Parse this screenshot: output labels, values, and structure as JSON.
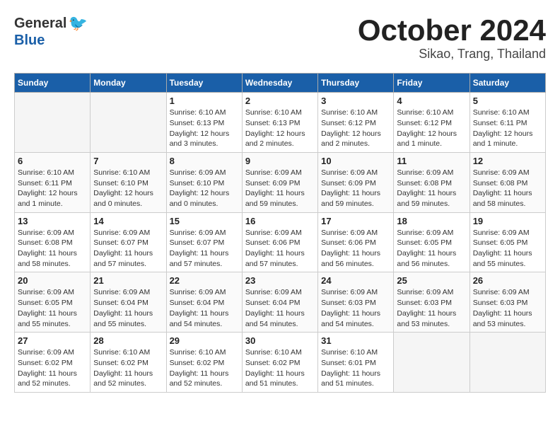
{
  "header": {
    "logo_general": "General",
    "logo_blue": "Blue",
    "month": "October 2024",
    "location": "Sikao, Trang, Thailand"
  },
  "weekdays": [
    "Sunday",
    "Monday",
    "Tuesday",
    "Wednesday",
    "Thursday",
    "Friday",
    "Saturday"
  ],
  "weeks": [
    [
      {
        "day": "",
        "empty": true
      },
      {
        "day": "",
        "empty": true
      },
      {
        "day": "1",
        "sunrise": "6:10 AM",
        "sunset": "6:13 PM",
        "daylight": "12 hours and 3 minutes."
      },
      {
        "day": "2",
        "sunrise": "6:10 AM",
        "sunset": "6:13 PM",
        "daylight": "12 hours and 2 minutes."
      },
      {
        "day": "3",
        "sunrise": "6:10 AM",
        "sunset": "6:12 PM",
        "daylight": "12 hours and 2 minutes."
      },
      {
        "day": "4",
        "sunrise": "6:10 AM",
        "sunset": "6:12 PM",
        "daylight": "12 hours and 1 minute."
      },
      {
        "day": "5",
        "sunrise": "6:10 AM",
        "sunset": "6:11 PM",
        "daylight": "12 hours and 1 minute."
      }
    ],
    [
      {
        "day": "6",
        "sunrise": "6:10 AM",
        "sunset": "6:11 PM",
        "daylight": "12 hours and 1 minute."
      },
      {
        "day": "7",
        "sunrise": "6:10 AM",
        "sunset": "6:10 PM",
        "daylight": "12 hours and 0 minutes."
      },
      {
        "day": "8",
        "sunrise": "6:09 AM",
        "sunset": "6:10 PM",
        "daylight": "12 hours and 0 minutes."
      },
      {
        "day": "9",
        "sunrise": "6:09 AM",
        "sunset": "6:09 PM",
        "daylight": "11 hours and 59 minutes."
      },
      {
        "day": "10",
        "sunrise": "6:09 AM",
        "sunset": "6:09 PM",
        "daylight": "11 hours and 59 minutes."
      },
      {
        "day": "11",
        "sunrise": "6:09 AM",
        "sunset": "6:08 PM",
        "daylight": "11 hours and 59 minutes."
      },
      {
        "day": "12",
        "sunrise": "6:09 AM",
        "sunset": "6:08 PM",
        "daylight": "11 hours and 58 minutes."
      }
    ],
    [
      {
        "day": "13",
        "sunrise": "6:09 AM",
        "sunset": "6:08 PM",
        "daylight": "11 hours and 58 minutes."
      },
      {
        "day": "14",
        "sunrise": "6:09 AM",
        "sunset": "6:07 PM",
        "daylight": "11 hours and 57 minutes."
      },
      {
        "day": "15",
        "sunrise": "6:09 AM",
        "sunset": "6:07 PM",
        "daylight": "11 hours and 57 minutes."
      },
      {
        "day": "16",
        "sunrise": "6:09 AM",
        "sunset": "6:06 PM",
        "daylight": "11 hours and 57 minutes."
      },
      {
        "day": "17",
        "sunrise": "6:09 AM",
        "sunset": "6:06 PM",
        "daylight": "11 hours and 56 minutes."
      },
      {
        "day": "18",
        "sunrise": "6:09 AM",
        "sunset": "6:05 PM",
        "daylight": "11 hours and 56 minutes."
      },
      {
        "day": "19",
        "sunrise": "6:09 AM",
        "sunset": "6:05 PM",
        "daylight": "11 hours and 55 minutes."
      }
    ],
    [
      {
        "day": "20",
        "sunrise": "6:09 AM",
        "sunset": "6:05 PM",
        "daylight": "11 hours and 55 minutes."
      },
      {
        "day": "21",
        "sunrise": "6:09 AM",
        "sunset": "6:04 PM",
        "daylight": "11 hours and 55 minutes."
      },
      {
        "day": "22",
        "sunrise": "6:09 AM",
        "sunset": "6:04 PM",
        "daylight": "11 hours and 54 minutes."
      },
      {
        "day": "23",
        "sunrise": "6:09 AM",
        "sunset": "6:04 PM",
        "daylight": "11 hours and 54 minutes."
      },
      {
        "day": "24",
        "sunrise": "6:09 AM",
        "sunset": "6:03 PM",
        "daylight": "11 hours and 54 minutes."
      },
      {
        "day": "25",
        "sunrise": "6:09 AM",
        "sunset": "6:03 PM",
        "daylight": "11 hours and 53 minutes."
      },
      {
        "day": "26",
        "sunrise": "6:09 AM",
        "sunset": "6:03 PM",
        "daylight": "11 hours and 53 minutes."
      }
    ],
    [
      {
        "day": "27",
        "sunrise": "6:09 AM",
        "sunset": "6:02 PM",
        "daylight": "11 hours and 52 minutes."
      },
      {
        "day": "28",
        "sunrise": "6:10 AM",
        "sunset": "6:02 PM",
        "daylight": "11 hours and 52 minutes."
      },
      {
        "day": "29",
        "sunrise": "6:10 AM",
        "sunset": "6:02 PM",
        "daylight": "11 hours and 52 minutes."
      },
      {
        "day": "30",
        "sunrise": "6:10 AM",
        "sunset": "6:02 PM",
        "daylight": "11 hours and 51 minutes."
      },
      {
        "day": "31",
        "sunrise": "6:10 AM",
        "sunset": "6:01 PM",
        "daylight": "11 hours and 51 minutes."
      },
      {
        "day": "",
        "empty": true
      },
      {
        "day": "",
        "empty": true
      }
    ]
  ]
}
